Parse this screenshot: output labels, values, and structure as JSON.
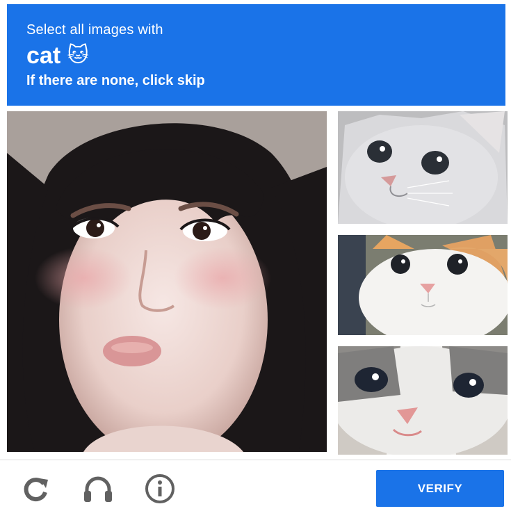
{
  "header": {
    "line1": "Select all images with",
    "target": "cat",
    "target_emoji": "🐱",
    "line3": "If there are none, click skip"
  },
  "tiles": [
    {
      "name": "woman-portrait"
    },
    {
      "name": "grey-cat"
    },
    {
      "name": "white-orange-cat"
    },
    {
      "name": "grey-white-kitten"
    }
  ],
  "footer": {
    "icons": [
      "reload-icon",
      "headphones-icon",
      "info-icon"
    ],
    "verify_label": "VERIFY"
  },
  "colors": {
    "accent": "#1a73e8",
    "icon": "#616161"
  }
}
